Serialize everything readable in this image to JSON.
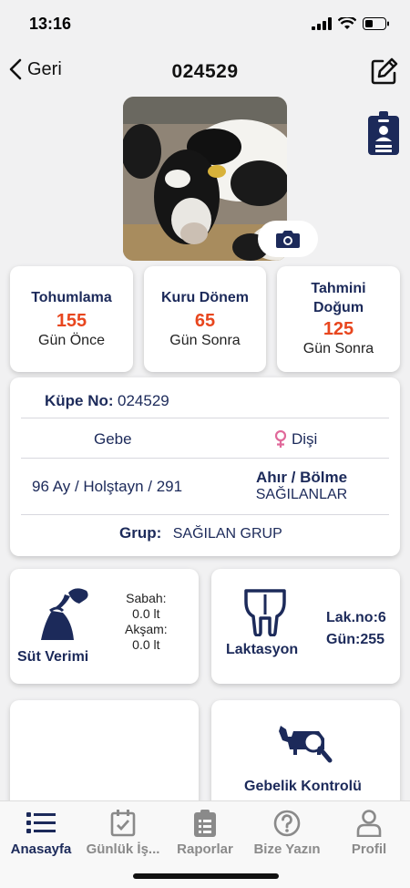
{
  "status": {
    "time": "13:16"
  },
  "nav": {
    "back_label": "Geri",
    "title": "024529"
  },
  "stats": [
    {
      "title": "Tohumlama",
      "value": "155",
      "sub": "Gün Önce"
    },
    {
      "title": "Kuru Dönem",
      "value": "65",
      "sub": "Gün Sonra"
    },
    {
      "title": "Tahmini Doğum",
      "value": "125",
      "sub": "Gün Sonra"
    }
  ],
  "info": {
    "tag_label": "Küpe No:",
    "tag_value": "024529",
    "status": "Gebe",
    "gender": "Dişi",
    "age_breed": "96 Ay / Holştayn / 291",
    "barn_label": "Ahır / Bölme",
    "barn_value": "SAĞILANLAR",
    "group_label": "Grup:",
    "group_value": "SAĞILAN GRUP"
  },
  "milk": {
    "title": "Süt Verimi",
    "morning_label": "Sabah:",
    "morning_value": "0.0 lt",
    "evening_label": "Akşam:",
    "evening_value": "0.0 lt"
  },
  "lactation": {
    "title": "Laktasyon",
    "lak_no": "Lak.no:6",
    "day": "Gün:255"
  },
  "pregnancy": {
    "title": "Gebelik Kontrolü"
  },
  "tabs": [
    {
      "label": "Anasayfa",
      "icon": "list-icon"
    },
    {
      "label": "Günlük İş...",
      "icon": "calendar-check-icon"
    },
    {
      "label": "Raporlar",
      "icon": "clipboard-icon"
    },
    {
      "label": "Bize Yazın",
      "icon": "question-icon"
    },
    {
      "label": "Profil",
      "icon": "user-icon"
    }
  ],
  "colors": {
    "primary": "#1c2a5a",
    "accent": "#e8461e",
    "female": "#e0699a"
  }
}
